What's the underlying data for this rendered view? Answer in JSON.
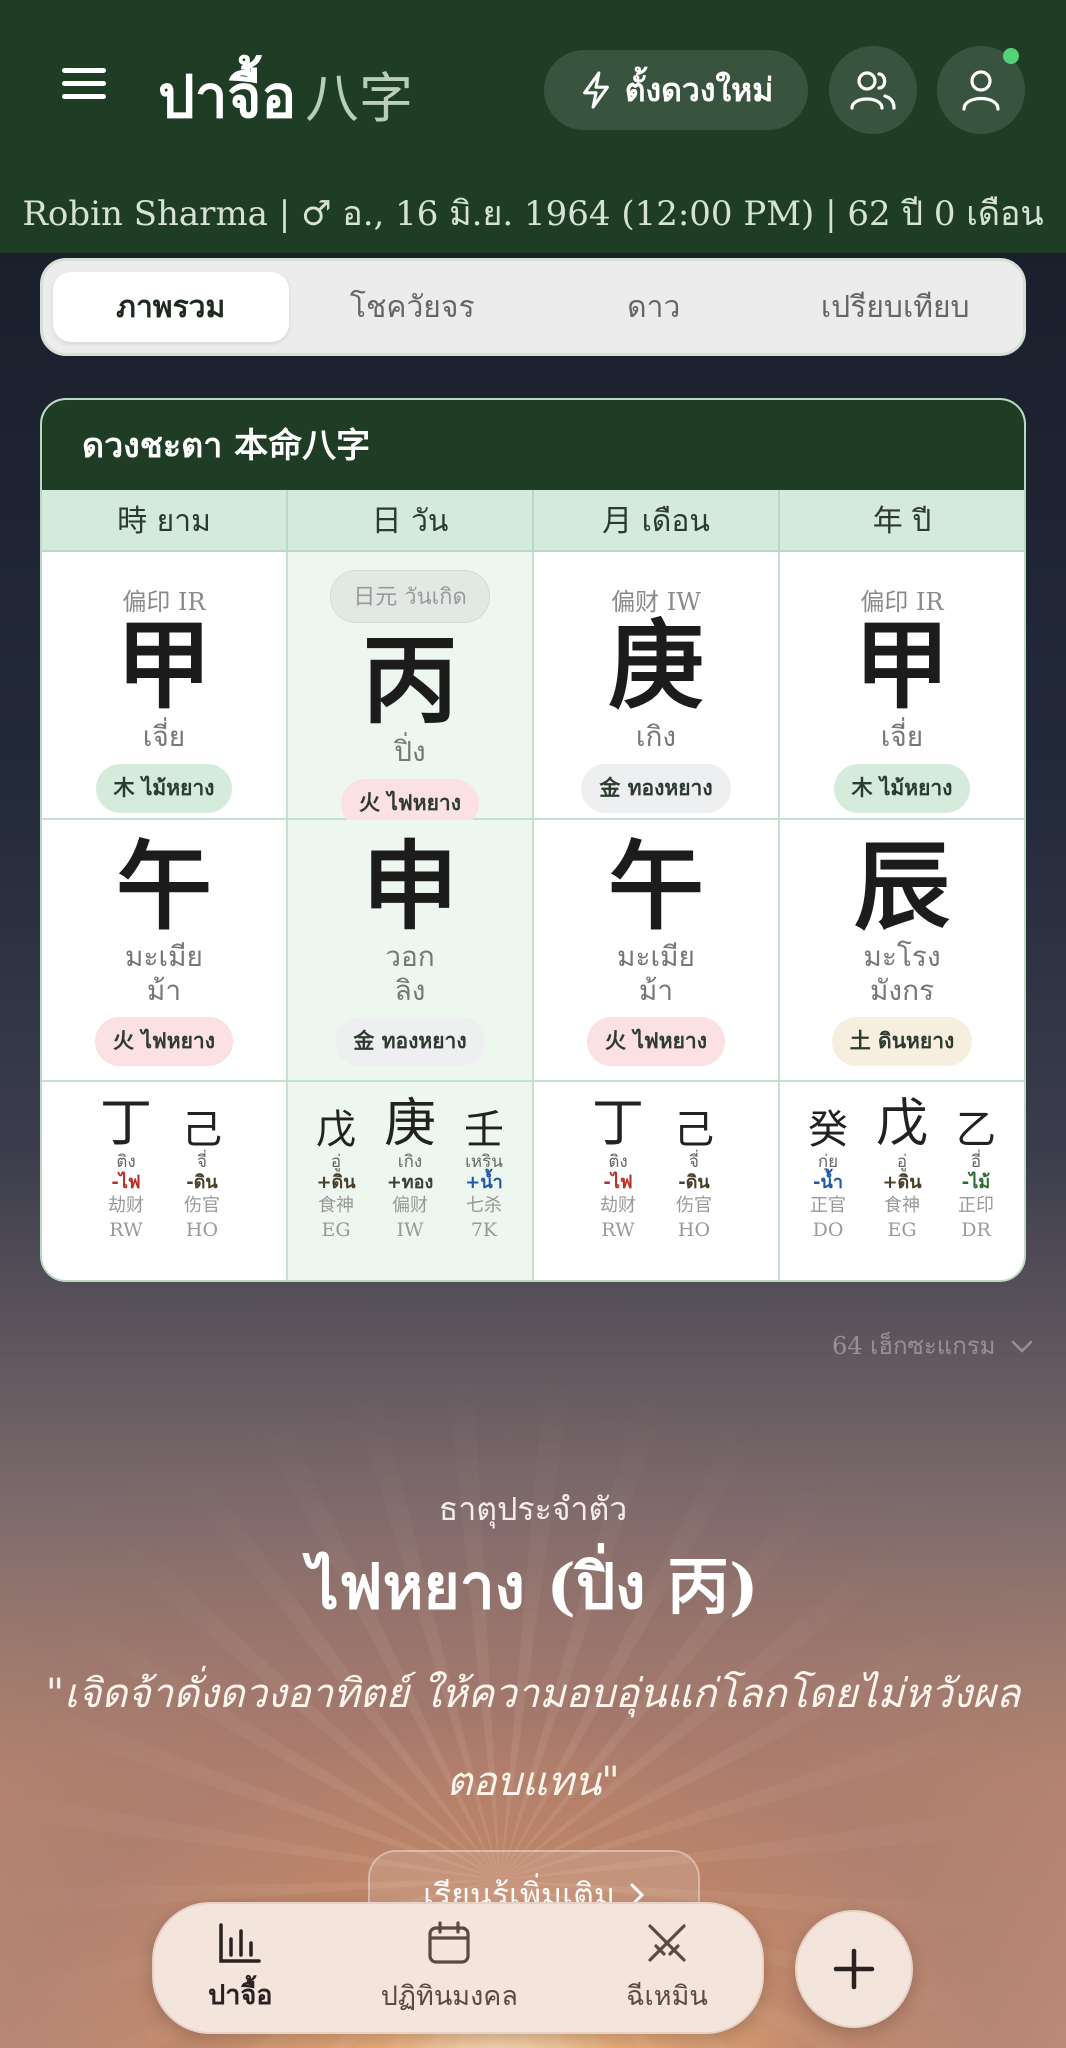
{
  "header": {
    "app_title": "ปาจื้อ",
    "app_title_cn": "八字",
    "new_chart_label": "ตั้งดวงใหม่",
    "profile_line": "Robin Sharma | ♂ อ., 16 มิ.ย. 1964 (12:00 PM) | 62 ปี 0 เดือน"
  },
  "tabs": [
    {
      "label": "ภาพรวม",
      "active": true
    },
    {
      "label": "โชควัยจร",
      "active": false
    },
    {
      "label": "ดาว",
      "active": false
    },
    {
      "label": "เปรียบเทียบ",
      "active": false
    }
  ],
  "chart": {
    "title": "ดวงชะตา 本命八字",
    "pillar_headers": [
      "時 ยาม",
      "日 วัน",
      "月 เดือน",
      "年 ปี"
    ],
    "stems": [
      {
        "god": "偏印 IR",
        "char": "甲",
        "reading": "เจี่ย",
        "element": "木 ไม้หยาง",
        "elem_class": "wood"
      },
      {
        "god": "日元 วันเกิด",
        "char": "丙",
        "reading": "ปิ่ง",
        "element": "火 ไฟหยาง",
        "elem_class": "fire"
      },
      {
        "god": "偏财 IW",
        "char": "庚",
        "reading": "เกิง",
        "element": "金 ทองหยาง",
        "elem_class": "metal"
      },
      {
        "god": "偏印 IR",
        "char": "甲",
        "reading": "เจี่ย",
        "element": "木 ไม้หยาง",
        "elem_class": "wood"
      }
    ],
    "branches": [
      {
        "char": "午",
        "reading1": "มะเมีย",
        "reading2": "ม้า",
        "element": "火 ไฟหยาง",
        "elem_class": "fire"
      },
      {
        "char": "申",
        "reading1": "วอก",
        "reading2": "ลิง",
        "element": "金 ทองหยาง",
        "elem_class": "metal"
      },
      {
        "char": "午",
        "reading1": "มะเมีย",
        "reading2": "ม้า",
        "element": "火 ไฟหยาง",
        "elem_class": "fire"
      },
      {
        "char": "辰",
        "reading1": "มะโรง",
        "reading2": "มังกร",
        "element": "土 ดินหยาง",
        "elem_class": "earth"
      }
    ],
    "hidden_stems": [
      [
        {
          "char": "丁",
          "reading": "ติง",
          "element": "-ไฟ",
          "el": "fire",
          "god": "劫财",
          "abbr": "RW",
          "main": true
        },
        {
          "char": "己",
          "reading": "จี่",
          "element": "-ดิน",
          "el": "earth",
          "god": "伤官",
          "abbr": "HO",
          "main": false
        }
      ],
      [
        {
          "char": "戊",
          "reading": "อู่",
          "element": "+ดิน",
          "el": "earth",
          "god": "食神",
          "abbr": "EG",
          "main": false
        },
        {
          "char": "庚",
          "reading": "เกิง",
          "element": "+ทอง",
          "el": "metal",
          "god": "偏财",
          "abbr": "IW",
          "main": true
        },
        {
          "char": "壬",
          "reading": "เหริน",
          "element": "+น้ำ",
          "el": "water",
          "god": "七杀",
          "abbr": "7K",
          "main": false
        }
      ],
      [
        {
          "char": "丁",
          "reading": "ติง",
          "element": "-ไฟ",
          "el": "fire",
          "god": "劫财",
          "abbr": "RW",
          "main": true
        },
        {
          "char": "己",
          "reading": "จี่",
          "element": "-ดิน",
          "el": "earth",
          "god": "伤官",
          "abbr": "HO",
          "main": false
        }
      ],
      [
        {
          "char": "癸",
          "reading": "กุ่ย",
          "element": "-น้ำ",
          "el": "water",
          "god": "正官",
          "abbr": "DO",
          "main": false
        },
        {
          "char": "戊",
          "reading": "อู่",
          "element": "+ดิน",
          "el": "earth",
          "god": "食神",
          "abbr": "EG",
          "main": true
        },
        {
          "char": "乙",
          "reading": "อี่",
          "element": "-ไม้",
          "el": "wood",
          "god": "正印",
          "abbr": "DR",
          "main": false
        }
      ]
    ]
  },
  "hexagram_link": "64 เฮ็กซะแกรม",
  "element_section": {
    "label": "ธาตุประจำตัว",
    "name": "ไฟหยาง (ปิ่ง 丙)",
    "quote": "\"เจิดจ้าดั่งดวงอาทิตย์ ให้ความอบอุ่นแก่โลกโดยไม่หวังผลตอบแทน\"",
    "learn_more": "เรียนรู้เพิ่มเติม"
  },
  "bottom_nav": [
    {
      "label": "ปาจื้อ",
      "icon": "chart-bars-icon",
      "active": true
    },
    {
      "label": "ปฏิทินมงคล",
      "icon": "calendar-icon",
      "active": false
    },
    {
      "label": "ฉีเหมิน",
      "icon": "crossed-swords-icon",
      "active": false
    }
  ],
  "colors": {
    "header_green": "#1e3d24",
    "fire": "#b8322a",
    "water": "#1f5aa8",
    "status_dot": "#54d27a"
  }
}
